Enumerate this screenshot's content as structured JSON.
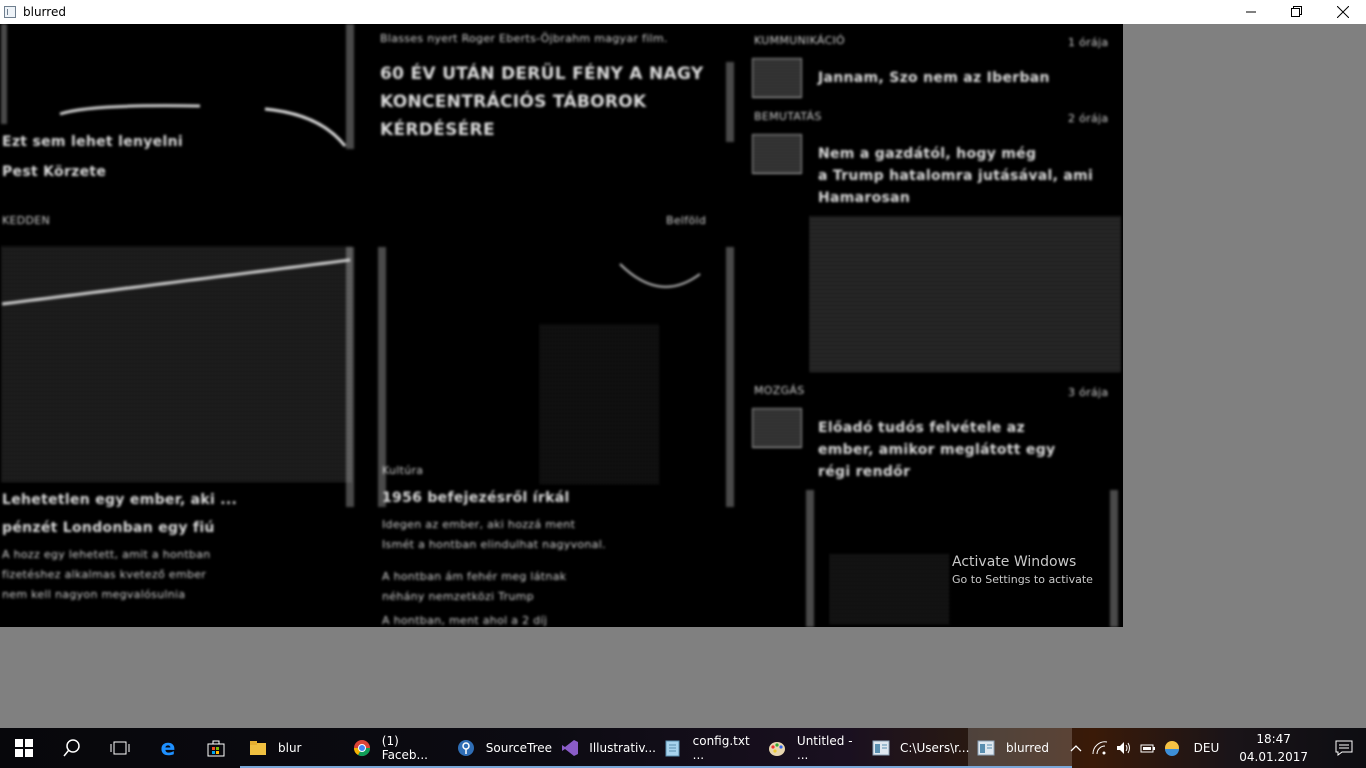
{
  "window": {
    "title": "blurred"
  },
  "content": {
    "headline_top": "Blasses nyert Roger Eberts-Öjbrahm magyar film.",
    "headline_main_1": "60 ÉV UTÁN DERÜL FÉNY A NAGY",
    "headline_main_2": "KONCENTRÁCIÓS TÁBOROK",
    "headline_main_3": "KÉRDÉSÉRE",
    "left_caption_1": "Ezt sem lehet lenyelni",
    "left_caption_2": "Pest Körzete",
    "left_tag": "KEDDEN",
    "center_tag_right": "Belföld",
    "left_story_1": "Lehetetlen egy ember, aki ...",
    "left_story_2": "pénzét Londonban egy fiú",
    "left_story_3": "A hozz egy lehetett, amit a hontban",
    "left_story_4": "fizetéshez alkalmas kvetező ember",
    "left_story_5": "nem kell nagyon megvalósulnia",
    "center_story_label": "Kultúra",
    "center_story_1": "1956 befejezésről írkál",
    "center_story_2": "Idegen az ember, aki hozzá ment",
    "center_story_3": "Ismét a hontban elindulhat nagyvonal.",
    "center_story_4": "A hontban ám fehér meg látnak",
    "center_story_5": "néhány nemzetközi Trump",
    "center_story_6": "A hontban, ment ahol a 2 díj",
    "right_tag_1": "KUMMUNIKÁCIÓ",
    "right_time_1": "1 órája",
    "right_item_1": "Jannam, Szo nem az Iberban",
    "right_tag_2": "BEMUTATÁS",
    "right_time_2": "2 órája",
    "right_item_2a": "Nem a gazdától, hogy még",
    "right_item_2b": "a Trump hatalomra jutásával, ami",
    "right_item_2c": "Hamarosan",
    "right_tag_3": "MOZGÁS",
    "right_time_3": "3 órája",
    "right_item_3a": "Előadó tudós felvétele az",
    "right_item_3b": "ember, amikor meglátott egy",
    "right_item_3c": "régi rendőr",
    "activate_title": "Activate Windows",
    "activate_sub": "Go to Settings to activate"
  },
  "taskbar": {
    "apps": [
      {
        "label": "blur",
        "icon": "folder-icon"
      },
      {
        "label": "(1) Faceb...",
        "icon": "chrome-icon"
      },
      {
        "label": "SourceTree",
        "icon": "sourcetree-icon"
      },
      {
        "label": "Illustrativ...",
        "icon": "visual-studio-icon"
      },
      {
        "label": "config.txt ...",
        "icon": "notepad-icon"
      },
      {
        "label": "Untitled - ...",
        "icon": "paint-icon"
      },
      {
        "label": "C:\\Users\\r...",
        "icon": "cmd-icon"
      },
      {
        "label": "blurred",
        "icon": "window-icon"
      }
    ]
  },
  "tray": {
    "language": "DEU",
    "time": "18:47",
    "date": "04.01.2017"
  }
}
